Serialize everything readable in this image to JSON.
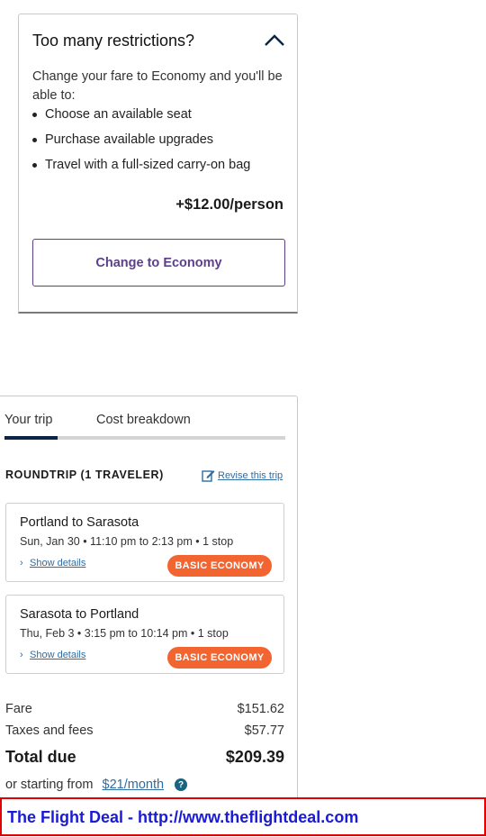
{
  "restrictions": {
    "title": "Too many restrictions?",
    "collapse_icon": "chevron-up-icon",
    "intro": "Change your fare to Economy and you'll be able to:",
    "benefits": [
      "Choose an available seat",
      "Purchase available upgrades",
      "Travel with a full-sized carry-on bag"
    ],
    "price_delta": "+$12.00/person",
    "button_label": "Change to Economy",
    "accent_color": "#5d3e8d"
  },
  "tabs": [
    {
      "label": "Your trip",
      "selected": true
    },
    {
      "label": "Cost breakdown",
      "selected": false
    }
  ],
  "trip": {
    "roundtrip_label": "ROUNDTRIP (1 TRAVELER)",
    "revise_icon": "edit-icon",
    "revise_label": "Revise this trip",
    "flights": [
      {
        "route": "Portland to Sarasota",
        "info": "Sun, Jan 30 • 11:10 pm to 2:13 pm • 1 stop",
        "details_label": "Show details",
        "badge": "BASIC ECONOMY"
      },
      {
        "route": "Sarasota to Portland",
        "info": "Thu, Feb 3 • 3:15 pm to 10:14 pm • 1 stop",
        "details_label": "Show details",
        "badge": "BASIC ECONOMY"
      }
    ],
    "badge_color": "#f26430"
  },
  "summary": {
    "fare_label": "Fare",
    "fare_value": "$151.62",
    "taxes_label": "Taxes and fees",
    "taxes_value": "$57.77",
    "total_label": "Total due",
    "total_value": "$209.39",
    "financing_prefix": "or starting from",
    "financing_link": "$21/month",
    "help_icon": "question-icon"
  },
  "watermark": {
    "text": "The Flight Deal - http://www.theflightdeal.com"
  }
}
